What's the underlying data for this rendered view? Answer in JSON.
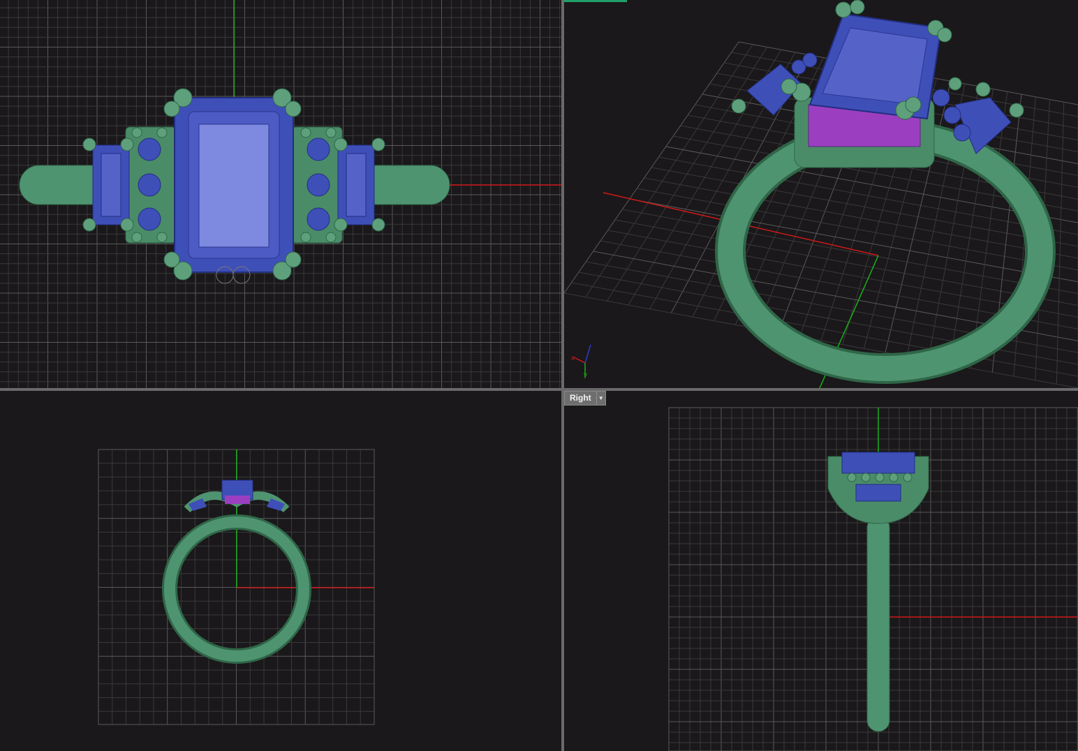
{
  "app": {
    "accent_color": "#1fa06a"
  },
  "viewports": {
    "top": {
      "label": ""
    },
    "perspective": {
      "label": "",
      "axis_widget": {
        "x_label": "x",
        "y_label": "y"
      }
    },
    "front": {
      "label": ""
    },
    "right": {
      "label": "Right",
      "menu_icon": "chevron-down-icon"
    }
  },
  "colors": {
    "metal": "#4f9470",
    "metal_dark": "#2f6648",
    "gem": "#3f4fb8",
    "gem_light": "#7e8ae0",
    "pavilion": "#9b3fc0",
    "grid_minor": "#3a3a3a",
    "grid_major": "#5a5a5a",
    "axis_x": "#d01818",
    "axis_y": "#18b018"
  }
}
